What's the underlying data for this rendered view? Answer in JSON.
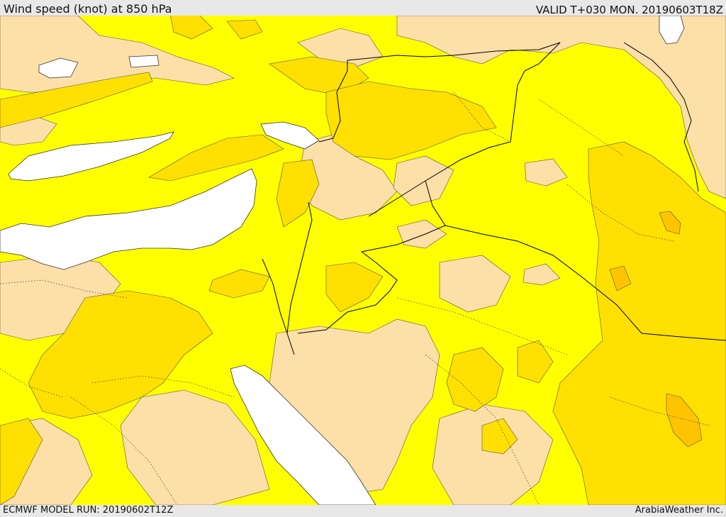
{
  "header": {
    "title": "Wind speed (knot) at 850 hPa",
    "valid": "VALID T+030 MON. 20190603T18Z"
  },
  "footer": {
    "model_run": "ECMWF MODEL RUN: 20190602T12Z",
    "credit": "ArabiaWeather Inc."
  },
  "colors": {
    "water": "#ffffff",
    "calm": "#fddfa8",
    "moderate": "#ffff00",
    "fresh": "#ffe000",
    "strong": "#ffc400",
    "stronger": "#ffaa00",
    "border": "#000000"
  }
}
